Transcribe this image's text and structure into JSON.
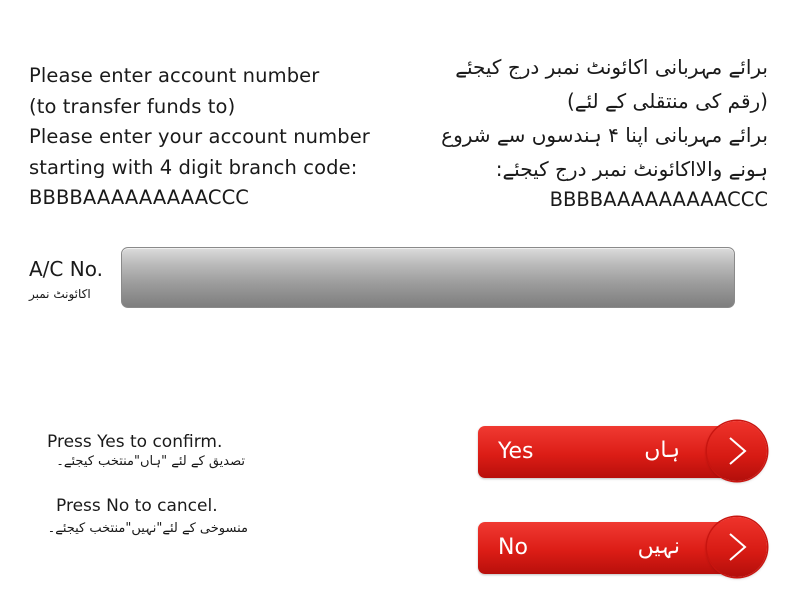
{
  "instructions": {
    "english": [
      "Please enter account number",
      "(to transfer funds to)",
      "Please enter your account number",
      "starting with 4 digit branch code:",
      "BBBBAAAAAAAAACCC"
    ],
    "urdu": [
      "برائے مہربانی اکائونٹ نمبر درج کیجئے",
      "(رقم کی منتقلی کے لئے)",
      "برائے مہربانی اپنا ۴ ہندسوں سے شروع",
      "ہونے والااکائونٹ نمبر درج کیجئے:",
      "BBBBAAAAAAAAACCC"
    ]
  },
  "account": {
    "label_en": "A/C No.",
    "label_ur": "اکائونٹ نمبر",
    "value": ""
  },
  "prompts": {
    "confirm_en": "Press Yes to confirm.",
    "confirm_ur": "تصدیق کے لئے \"ہاں\"منتخب کیجئے۔",
    "cancel_en": "Press No to cancel.",
    "cancel_ur": "منسوخی کے لئے\"نہیں\"منتخب کیجئے۔"
  },
  "buttons": {
    "yes": {
      "label_en": "Yes",
      "label_ur": "ہاں",
      "icon": "chevron-right-icon"
    },
    "no": {
      "label_en": "No",
      "label_ur": "نہیں",
      "icon": "chevron-right-icon"
    }
  },
  "colors": {
    "button_red": "#dc1d16",
    "field_gray": "#9c9c9c",
    "text": "#1a1a1a"
  }
}
